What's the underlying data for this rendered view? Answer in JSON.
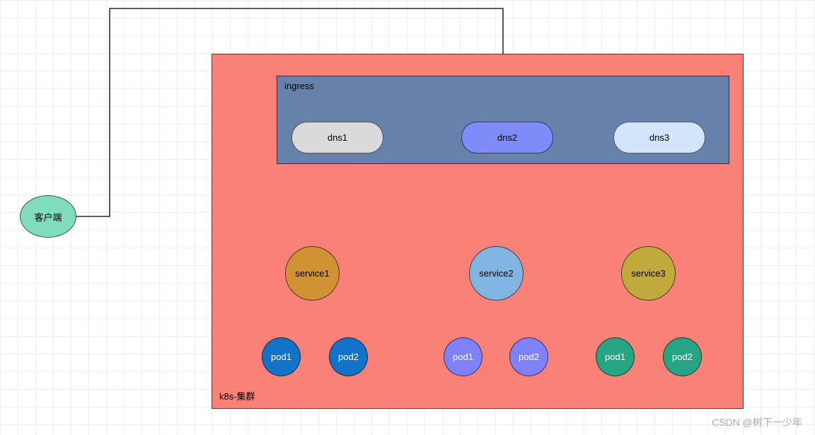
{
  "client": {
    "label": "客户端"
  },
  "cluster": {
    "label": "k8s-集群"
  },
  "ingress": {
    "label": "ingress",
    "dns": [
      {
        "id": "dns1",
        "label": "dns1"
      },
      {
        "id": "dns2",
        "label": "dns2"
      },
      {
        "id": "dns3",
        "label": "dns3"
      }
    ]
  },
  "services": [
    {
      "id": "service1",
      "label": "service1",
      "pods": [
        {
          "id": "p11",
          "label": "pod1"
        },
        {
          "id": "p12",
          "label": "pod2"
        }
      ]
    },
    {
      "id": "service2",
      "label": "service2",
      "pods": [
        {
          "id": "p21",
          "label": "pod1"
        },
        {
          "id": "p22",
          "label": "pod2"
        }
      ]
    },
    {
      "id": "service3",
      "label": "service3",
      "pods": [
        {
          "id": "p31",
          "label": "pod1"
        },
        {
          "id": "p32",
          "label": "pod2"
        }
      ]
    }
  ],
  "watermark": "CSDN @树下一少年"
}
